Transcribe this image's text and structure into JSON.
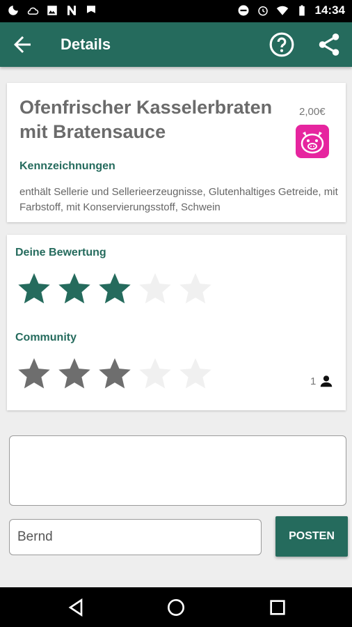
{
  "status_bar": {
    "time": "14:34",
    "icons": [
      "moon-icon",
      "cloud-icon",
      "image-icon",
      "n-icon",
      "flag-icon",
      "dnd-icon",
      "alarm-icon",
      "wifi-icon",
      "battery-icon"
    ]
  },
  "app_bar": {
    "title": "Details",
    "icons": [
      "back-arrow-icon",
      "help-icon",
      "share-icon"
    ]
  },
  "dish": {
    "title": "Ofenfrischer Kasselerbraten mit Bratensauce",
    "price": "2,00€",
    "badge_icon": "pig-icon",
    "labels_heading": "Kennzeichnungen",
    "allergens": "enthält Sellerie und Sellerieerzeugnisse, Glutenhaltiges Getreide, mit Farbstoff, mit Konservierungsstoff, Schwein"
  },
  "ratings": {
    "user_heading": "Deine Bewertung",
    "user_stars": 3,
    "community_heading": "Community",
    "community_stars": 3,
    "max_stars": 5,
    "community_count": "1",
    "user_color": "#256b5d",
    "community_color": "#6e6e6e",
    "empty_color": "#f0f0f0"
  },
  "comment": {
    "text": "",
    "name_value": "Bernd",
    "post_label": "POSTEN"
  },
  "colors": {
    "primary": "#256b5d",
    "badge": "#e6259f"
  }
}
